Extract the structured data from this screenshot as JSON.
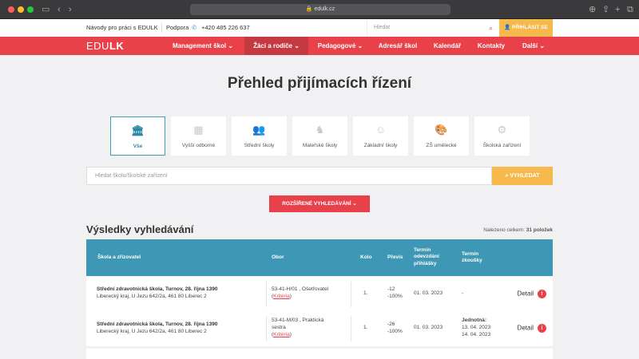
{
  "browser": {
    "url": "edulk.cz"
  },
  "topbar": {
    "guide": "Návody pro práci s EDULK",
    "support": "Podpora",
    "phone": "+420 485 226 637",
    "search_placeholder": "Hledat",
    "login_label": "PŘIHLÁSIT SE"
  },
  "nav": {
    "logo_a": "EDU",
    "logo_b": "LK",
    "items": [
      {
        "label": "Management škol ⌄"
      },
      {
        "label": "Žáci a rodiče ⌄"
      },
      {
        "label": "Pedagogové ⌄"
      },
      {
        "label": "Adresář škol"
      },
      {
        "label": "Kalendář"
      },
      {
        "label": "Kontakty"
      },
      {
        "label": "Další ⌄"
      }
    ]
  },
  "page_title": "Přehled přijímacích řízení",
  "categories": [
    {
      "label": "Vše",
      "icon": "building-icon"
    },
    {
      "label": "Vyšší odborné",
      "icon": "board-icon"
    },
    {
      "label": "Střední školy",
      "icon": "students-icon"
    },
    {
      "label": "Mateřské školy",
      "icon": "rocking-horse-icon"
    },
    {
      "label": "Základní školy",
      "icon": "child-face-icon"
    },
    {
      "label": "ZŠ umělecké",
      "icon": "palette-icon"
    },
    {
      "label": "Školská zařízení",
      "icon": "gear-icon"
    }
  ],
  "search": {
    "placeholder": "Hledat školu/školské zařízení",
    "button": "VYHLEDAT"
  },
  "advanced_button": "ROZŠÍŘENÉ VYHLEDÁVÁNÍ ⌄",
  "results": {
    "title": "Výsledky vyhledávání",
    "found_prefix": "Nalezeno celkem: ",
    "found_count": "31 položek"
  },
  "table": {
    "headers": {
      "school": "Škola a zřizovatel",
      "field": "Obor",
      "round": "Kolo",
      "overflow": "Převis",
      "deadline": "Termín odevzdání přihlášky",
      "exam": "Termín zkoušky"
    },
    "rows": [
      {
        "school": "Střední zdravotnická škola, Turnov, 28. října 1390",
        "address": "Liberecký kraj, U Jezu 642/2a, 461 80 Liberec 2",
        "field": "53-41-H/01 , Ošetřovatel",
        "field_line2": "",
        "criteria": "Kritéria",
        "round": "1.",
        "overflow1": "-12",
        "overflow2": "-100%",
        "deadline": "01. 03. 2023",
        "exam_label": "",
        "exam1": "-",
        "exam2": "",
        "detail": "Detail"
      },
      {
        "school": "Střední zdravotnická škola, Turnov, 28. října 1390",
        "address": "Liberecký kraj, U Jezu 642/2a, 461 80 Liberec 2",
        "field": "53-41-M/03 , Praktická",
        "field_line2": "sestra",
        "criteria": "Kritéria",
        "round": "1.",
        "overflow1": "-26",
        "overflow2": "-100%",
        "deadline": "01. 03. 2023",
        "exam_label": "Jednotná:",
        "exam1": "13. 04. 2023",
        "exam2": "14. 04. 2023",
        "detail": "Detail"
      }
    ]
  }
}
